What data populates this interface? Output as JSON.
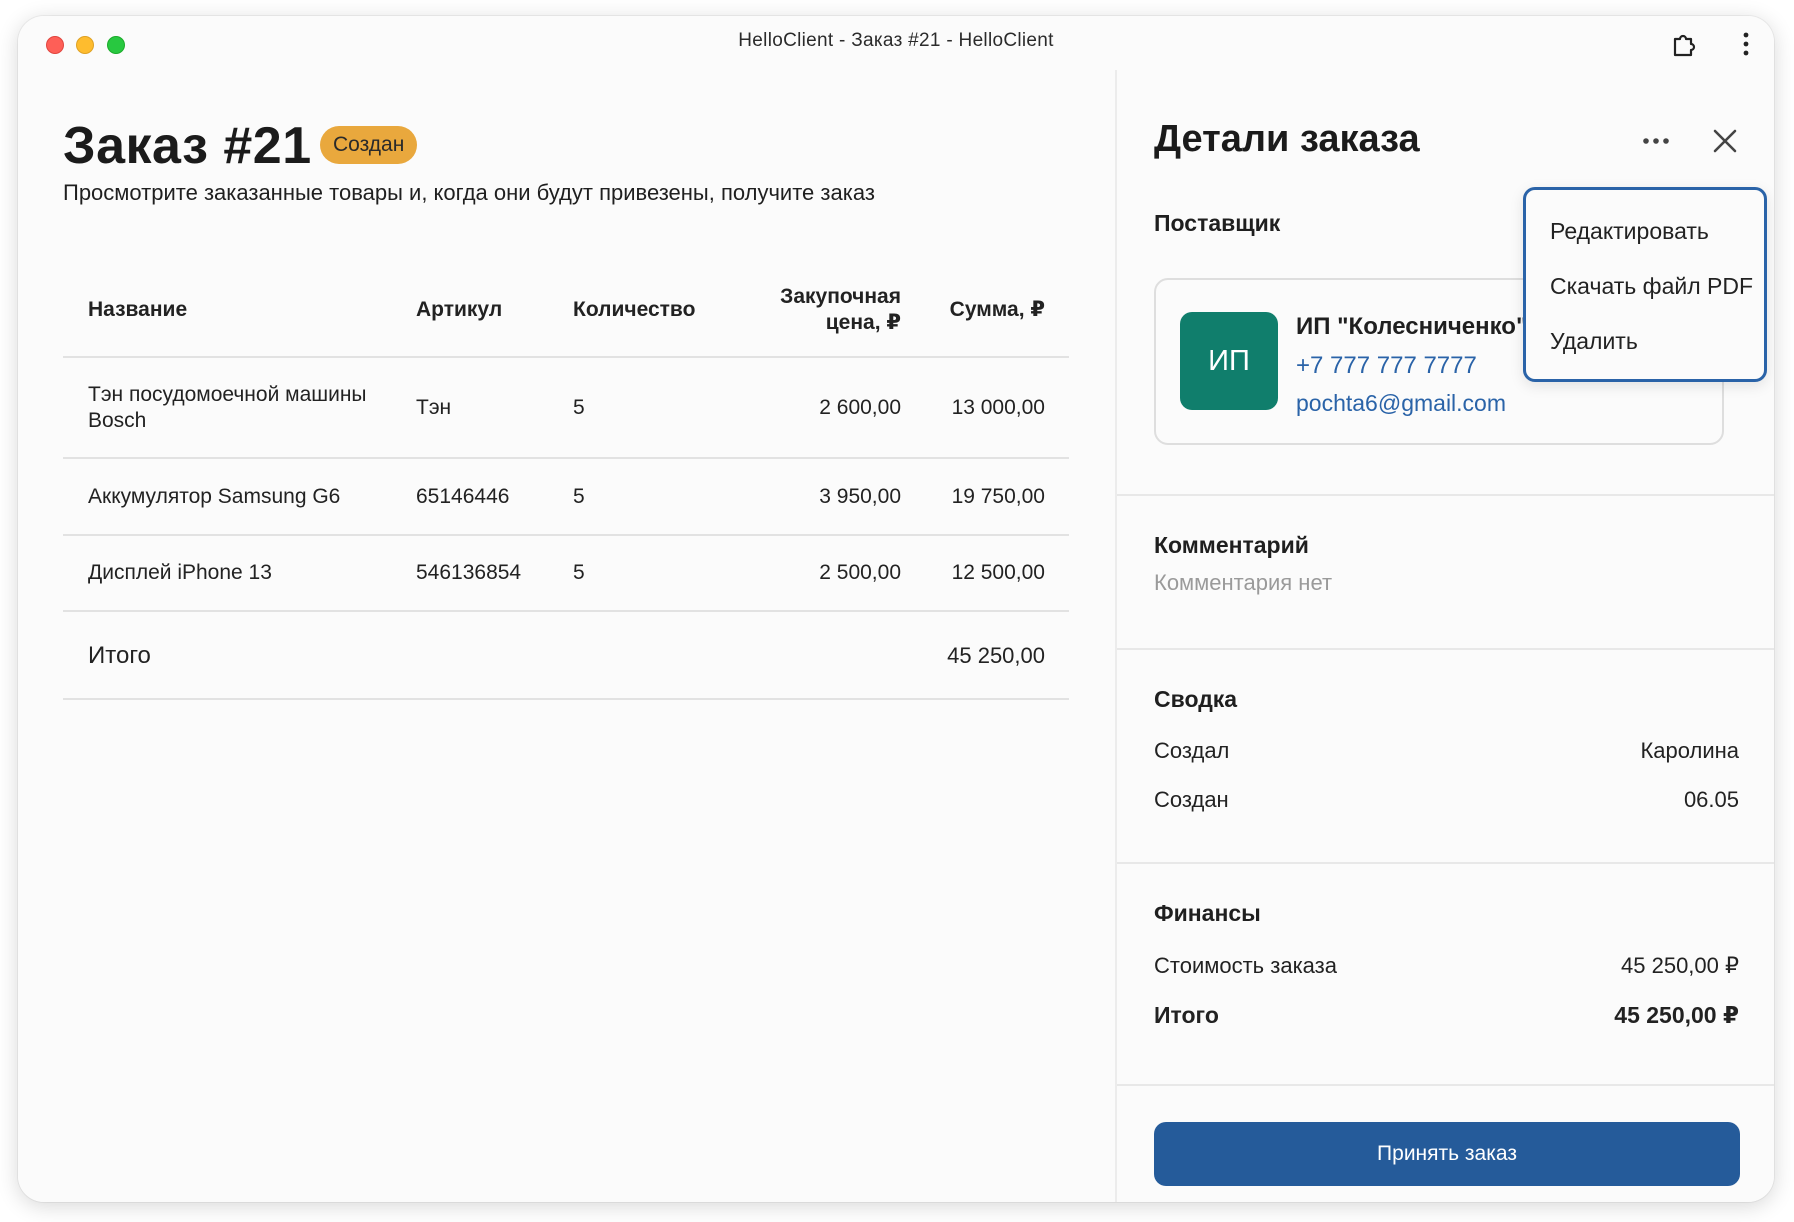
{
  "window": {
    "title": "HelloClient - Заказ #21 - HelloClient"
  },
  "order": {
    "title": "Заказ #21",
    "status": "Создан",
    "subtitle": "Просмотрите заказанные товары и, когда они будут привезены, получите заказ"
  },
  "table": {
    "headers": {
      "name": "Название",
      "article": "Артикул",
      "quantity": "Количество",
      "price_line1": "Закупочная",
      "price_line2": "цена, ₽",
      "sum": "Сумма, ₽"
    },
    "rows": [
      {
        "name_line1": "Тэн посудомоечной машины",
        "name_line2": "Bosch",
        "article": "Тэн",
        "quantity": "5",
        "price": "2 600,00",
        "sum": "13 000,00"
      },
      {
        "name_line1": "Аккумулятор Samsung G6",
        "name_line2": "",
        "article": "65146446",
        "quantity": "5",
        "price": "3 950,00",
        "sum": "19 750,00"
      },
      {
        "name_line1": "Дисплей iPhone 13",
        "name_line2": "",
        "article": "546136854",
        "quantity": "5",
        "price": "2 500,00",
        "sum": "12 500,00"
      }
    ],
    "total_label": "Итого",
    "total_value": "45 250,00"
  },
  "panel": {
    "title": "Детали заказа",
    "supplier": {
      "heading": "Поставщик",
      "avatar": "ИП",
      "name": "ИП \"Колесниченко\"",
      "phone": "+7 777 777 7777",
      "email": "pochta6@gmail.com"
    },
    "comment": {
      "heading": "Комментарий",
      "text": "Комментария нет"
    },
    "summary": {
      "heading": "Сводка",
      "created_by_label": "Создал",
      "created_by_value": "Каролина",
      "created_label": "Создан",
      "created_value": "06.05"
    },
    "finance": {
      "heading": "Финансы",
      "cost_label": "Стоимость заказа",
      "cost_value": "45 250,00 ₽",
      "total_label": "Итого",
      "total_value": "45 250,00 ₽"
    },
    "accept_button": "Принять заказ"
  },
  "menu": {
    "items": [
      "Редактировать",
      "Скачать файл PDF",
      "Удалить"
    ]
  },
  "colors": {
    "accent": "#255b9a",
    "link": "#2a63a8",
    "badge": "#e9a83d",
    "avatar": "#107e6c"
  },
  "icons": {
    "window": [
      "close-dot",
      "minimize-dot",
      "zoom-dot",
      "extension-icon",
      "more-vertical-icon"
    ],
    "panel": [
      "more-horizontal-icon",
      "close-icon",
      "chevron-down-icon"
    ]
  }
}
